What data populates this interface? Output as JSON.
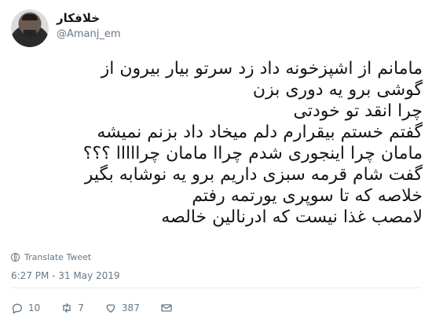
{
  "user": {
    "display_name": "خلافکار",
    "handle": "@Amanj_em"
  },
  "tweet": {
    "lines": [
      "مامانم از اشپزخونه داد زد سرتو بیار بیرون از",
      "گوشی برو یه دوری بزن",
      "چرا انقد تو خودتی",
      "گفتم خستم بیقرارم دلم میخاد داد بزنم نمیشه",
      "مامان چرا اینجوری شدم چراا مامان چرااااا ؟؟؟",
      "گفت شام قرمه سبزی داریم برو یه نوشابه بگیر",
      "خلاصه که تا سوپری یورتمه رفتم",
      "لامصب غذا نیست که ادرنالین خالصه"
    ]
  },
  "translate_label": "Translate Tweet",
  "timestamp": "6:27 PM - 31 May 2019",
  "actions": {
    "reply_count": "10",
    "retweet_count": "7",
    "like_count": "387"
  },
  "icons": {
    "translate": "globe-icon",
    "reply": "reply-icon",
    "retweet": "retweet-icon",
    "like": "heart-icon",
    "dm": "mail-icon"
  }
}
